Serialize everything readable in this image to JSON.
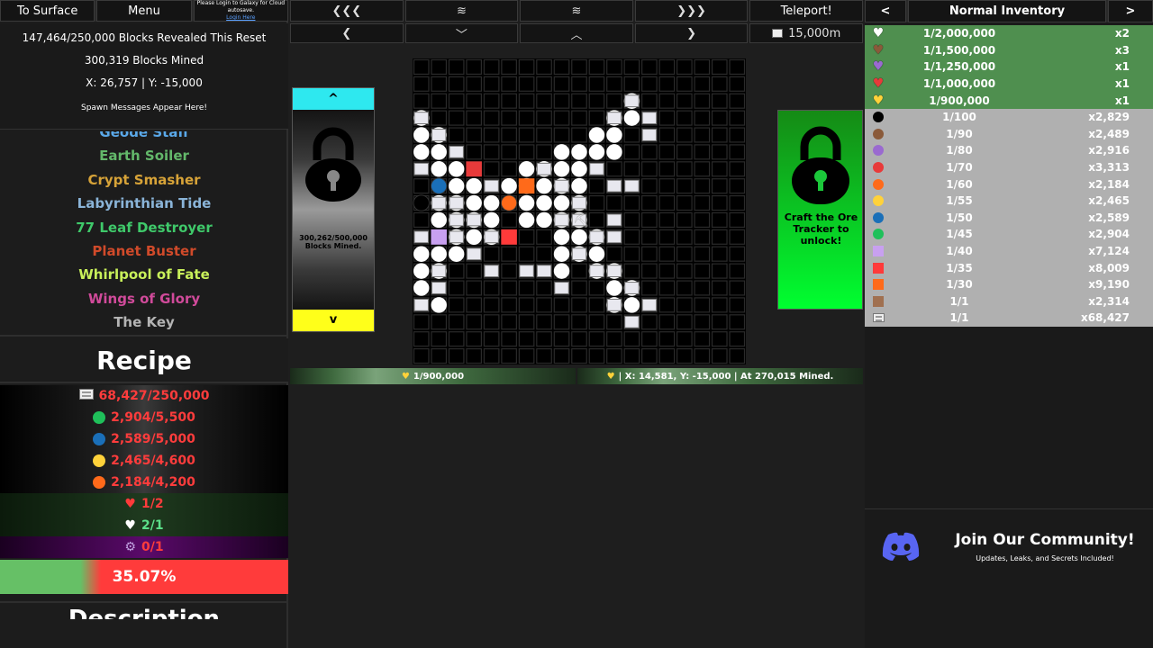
{
  "left": {
    "buttons": {
      "surface": "To Surface",
      "menu": "Menu",
      "login_line1": "Please Login to Galaxy for Cloud autosave.",
      "login_link": "Login Here"
    },
    "stats": {
      "revealed": "147,464/250,000 Blocks Revealed This Reset",
      "mined": "300,319 Blocks Mined",
      "coords": "X: 26,757 | Y: -15,000",
      "spawn": "Spawn Messages Appear Here!"
    },
    "ores": [
      {
        "name": "Geode Staff",
        "color": "#5aa8e8"
      },
      {
        "name": "Earth Soiler",
        "color": "#63b86a"
      },
      {
        "name": "Crypt Smasher",
        "color": "#d7a338"
      },
      {
        "name": "Labyrinthian Tide",
        "color": "#8ab4d8"
      },
      {
        "name": "77 Leaf Destroyer",
        "color": "#3fc96a"
      },
      {
        "name": "Planet Buster",
        "color": "#d04a2a"
      },
      {
        "name": "Whirlpool of Fate",
        "color": "#c8f05a"
      },
      {
        "name": "Wings of Glory",
        "color": "#d04a9a"
      },
      {
        "name": "The Key",
        "color": "#b4b4b4"
      }
    ],
    "recipe_title": "Recipe",
    "recipe": [
      {
        "icon": "block",
        "text": "68,427/250,000",
        "ok": false
      },
      {
        "icon": "#1fc05a",
        "text": "2,904/5,500",
        "ok": false
      },
      {
        "icon": "#1a6fb8",
        "text": "2,589/5,000",
        "ok": false
      },
      {
        "icon": "#ffd23a",
        "text": "2,465/4,600",
        "ok": false
      },
      {
        "icon": "#ff6a1a",
        "text": "2,184/4,200",
        "ok": false
      },
      {
        "icon": "heart-red",
        "text": "1/2",
        "ok": false
      },
      {
        "icon": "heart-white",
        "text": "2/1",
        "ok": true
      },
      {
        "icon": "gear",
        "text": "0/1",
        "ok": false
      }
    ],
    "progress": {
      "text": "35.07%",
      "value": 0.3507
    },
    "description_title": "Description"
  },
  "center": {
    "nav_top": [
      "❮❮❮",
      "≋",
      "≋",
      "❯❯❯",
      "Teleport!"
    ],
    "nav_bottom": [
      "❮",
      "﹀",
      "︿",
      "❯",
      "15,000m"
    ],
    "left_panel": {
      "up": "^",
      "down": "v",
      "caption": "300,262/500,000 Blocks Mined."
    },
    "right_panel": {
      "caption": "Craft the Ore Tracker to unlock!"
    },
    "status_left": "1/900,000",
    "status_right": "| X: 14,581, Y: -15,000 | At 270,015 Mined."
  },
  "right": {
    "title": "Normal Inventory",
    "prev": "<",
    "next": ">",
    "items": [
      {
        "icon": "#ffffff",
        "shape": "heart",
        "rarity": "1/2,000,000",
        "count": "x2",
        "rare": true
      },
      {
        "icon": "#8a5a3a",
        "shape": "heart",
        "rarity": "1/1,500,000",
        "count": "x3",
        "rare": true
      },
      {
        "icon": "#9a6ad0",
        "shape": "heart",
        "rarity": "1/1,250,000",
        "count": "x1",
        "rare": true
      },
      {
        "icon": "#e83a3a",
        "shape": "heart",
        "rarity": "1/1,000,000",
        "count": "x1",
        "rare": true
      },
      {
        "icon": "#ffd23a",
        "shape": "heart",
        "rarity": "1/900,000",
        "count": "x1",
        "rare": true
      },
      {
        "icon": "#000000",
        "shape": "circle",
        "rarity": "1/100",
        "count": "x2,829",
        "rare": false
      },
      {
        "icon": "#8a5a3a",
        "shape": "circle",
        "rarity": "1/90",
        "count": "x2,489",
        "rare": false
      },
      {
        "icon": "#9a6ad0",
        "shape": "circle",
        "rarity": "1/80",
        "count": "x2,916",
        "rare": false
      },
      {
        "icon": "#e83a3a",
        "shape": "circle",
        "rarity": "1/70",
        "count": "x3,313",
        "rare": false
      },
      {
        "icon": "#ff6a1a",
        "shape": "circle",
        "rarity": "1/60",
        "count": "x2,184",
        "rare": false
      },
      {
        "icon": "#ffd23a",
        "shape": "circle",
        "rarity": "1/55",
        "count": "x2,465",
        "rare": false
      },
      {
        "icon": "#1a6fb8",
        "shape": "circle",
        "rarity": "1/50",
        "count": "x2,589",
        "rare": false
      },
      {
        "icon": "#1fc05a",
        "shape": "circle",
        "rarity": "1/45",
        "count": "x2,904",
        "rare": false
      },
      {
        "icon": "#c8a0f0",
        "shape": "square",
        "rarity": "1/40",
        "count": "x7,124",
        "rare": false
      },
      {
        "icon": "#ff3a3a",
        "shape": "square",
        "rarity": "1/35",
        "count": "x8,009",
        "rare": false
      },
      {
        "icon": "#ff6a1a",
        "shape": "square",
        "rarity": "1/30",
        "count": "x9,190",
        "rare": false
      },
      {
        "icon": "#a07050",
        "shape": "square",
        "rarity": "1/1",
        "count": "x2,314",
        "rare": false
      },
      {
        "icon": "block",
        "shape": "block",
        "rarity": "1/1",
        "count": "x68,427",
        "rare": false
      }
    ],
    "community": {
      "title": "Join Our Community!",
      "subtitle": "Updates, Leaks, and Secrets Included!"
    }
  }
}
